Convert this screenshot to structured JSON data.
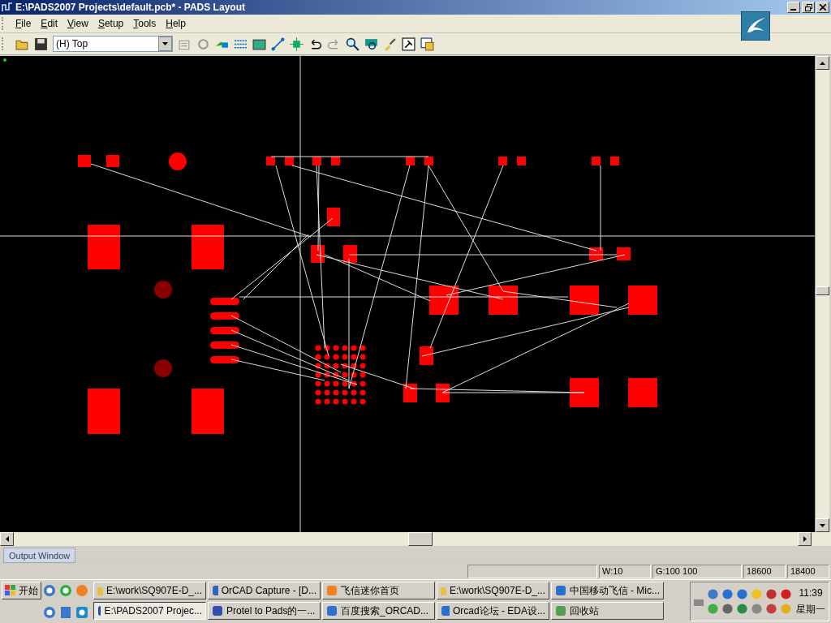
{
  "window": {
    "title": "E:\\PADS2007 Projects\\default.pcb* - PADS Layout"
  },
  "menu": [
    {
      "label": "File"
    },
    {
      "label": "Edit"
    },
    {
      "label": "View"
    },
    {
      "label": "Setup"
    },
    {
      "label": "Tools"
    },
    {
      "label": "Help"
    }
  ],
  "toolbar": {
    "layer": "(H) Top"
  },
  "output_tab": {
    "label": "Output Window"
  },
  "status_bar": [
    {
      "kind": "blank"
    },
    {
      "kind": "text",
      "text": "W:10"
    },
    {
      "kind": "text",
      "text": "G:100 100"
    },
    {
      "kind": "text",
      "text": "18600"
    },
    {
      "kind": "text",
      "text": "18400"
    }
  ],
  "taskbar": {
    "start": "开始",
    "buttons": [
      {
        "label": "E:\\work\\SQ907E-D_...",
        "kind": "folder",
        "selected": false
      },
      {
        "label": "OrCAD Capture - [D...",
        "kind": "app",
        "selected": false
      },
      {
        "label": "飞信迷你首页",
        "kind": "chat",
        "selected": false
      },
      {
        "label": "E:\\work\\SQ907E-D_...",
        "kind": "folder",
        "selected": false
      },
      {
        "label": "中国移动飞信 - Mic...",
        "kind": "browser",
        "selected": false
      },
      {
        "label": "E:\\PADS2007 Projec...",
        "kind": "pads",
        "selected": true
      },
      {
        "label": "Protel to Pads的一...",
        "kind": "doc",
        "selected": false
      },
      {
        "label": "百度搜索_ORCAD...",
        "kind": "web",
        "selected": false
      },
      {
        "label": "Orcad论坛 - EDA设...",
        "kind": "browser",
        "selected": false
      },
      {
        "label": "回收站",
        "kind": "recycle",
        "selected": false
      }
    ],
    "clock": "11:39",
    "day": "星期一"
  }
}
